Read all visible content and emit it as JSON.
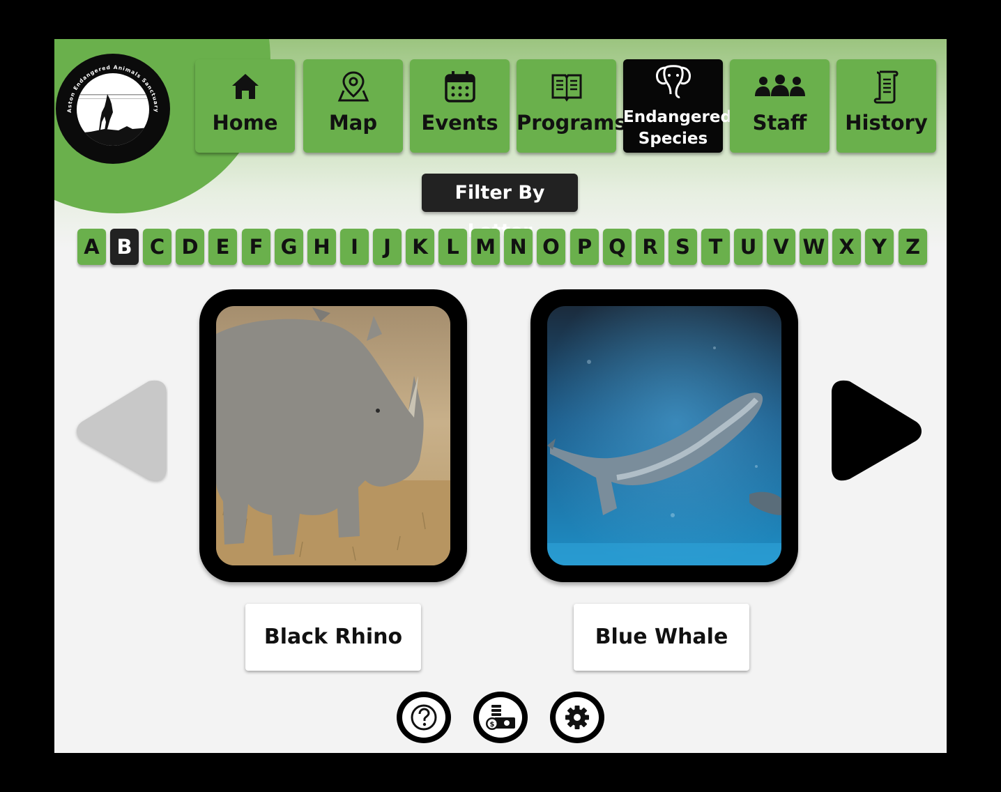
{
  "logo": {
    "name": "Aston Endangered Animals Sanctuary"
  },
  "nav": [
    {
      "label": "Home",
      "icon": "home-icon",
      "active": false
    },
    {
      "label": "Map",
      "icon": "map-pin-icon",
      "active": false
    },
    {
      "label": "Events",
      "icon": "calendar-icon",
      "active": false
    },
    {
      "label": "Programs",
      "icon": "book-icon",
      "active": false
    },
    {
      "label_line1": "Endangered",
      "label_line2": "Species",
      "icon": "elephant-icon",
      "active": true
    },
    {
      "label": "Staff",
      "icon": "people-icon",
      "active": false
    },
    {
      "label": "History",
      "icon": "scroll-icon",
      "active": false
    }
  ],
  "filter": {
    "label": "Filter By Letter",
    "letters": [
      "A",
      "B",
      "C",
      "D",
      "E",
      "F",
      "G",
      "H",
      "I",
      "J",
      "K",
      "L",
      "M",
      "N",
      "O",
      "P",
      "Q",
      "R",
      "S",
      "T",
      "U",
      "V",
      "W",
      "X",
      "Y",
      "Z"
    ],
    "selected": "B"
  },
  "animals": [
    {
      "name": "Black Rhino",
      "image": "rhino-photo"
    },
    {
      "name": "Blue Whale",
      "image": "whale-photo"
    }
  ],
  "carousel": {
    "prev_enabled": false,
    "next_enabled": true
  },
  "footer": {
    "buttons": [
      "help-icon",
      "donate-icon",
      "settings-icon"
    ]
  },
  "colors": {
    "accent": "#6ab04c",
    "active": "#070707",
    "background": "#f3f3f3"
  }
}
